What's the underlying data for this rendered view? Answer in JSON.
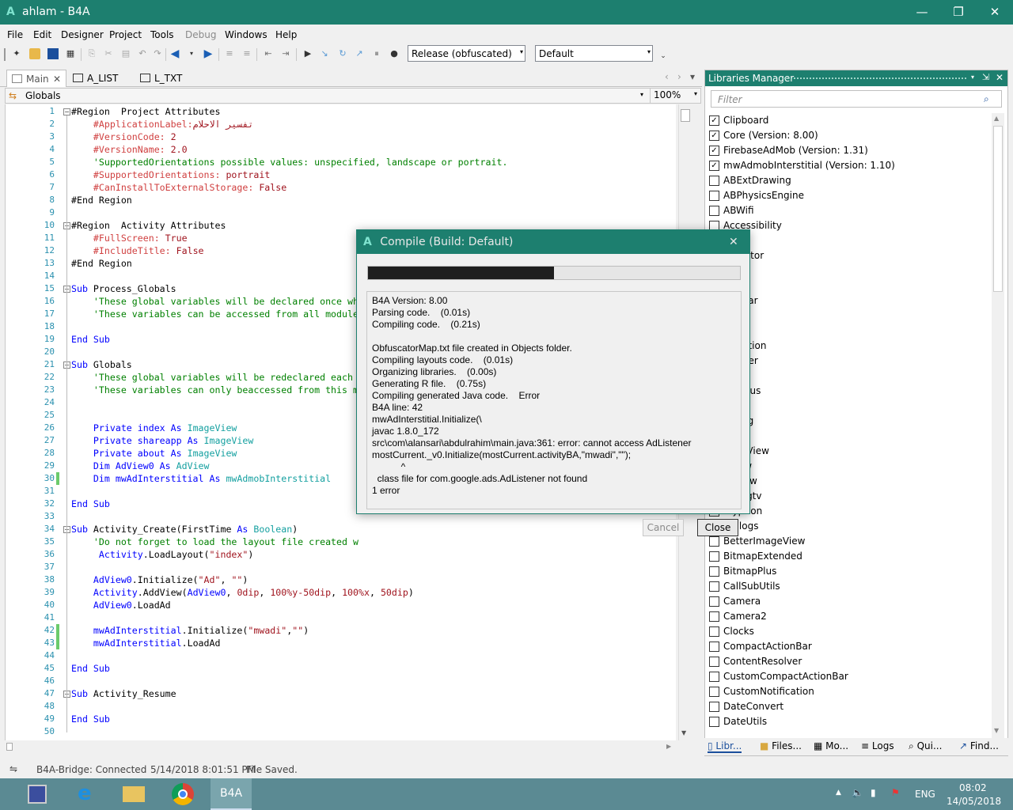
{
  "window": {
    "logo": "A",
    "title": "ahlam - B4A",
    "min": "—",
    "max": "❐",
    "close": "✕"
  },
  "menu": [
    "File",
    "Edit",
    "Designer",
    "Project",
    "Tools",
    "Debug",
    "Windows",
    "Help"
  ],
  "toolbar": {
    "build_config": "Release (obfuscated)",
    "build_config_arrow": "▾",
    "device": "Default",
    "device_arrow": "▾",
    "overflow": "⌄"
  },
  "tabs": [
    {
      "label": "Main",
      "close": "✕"
    },
    {
      "label": "A_LIST"
    },
    {
      "label": "L_TXT"
    }
  ],
  "tab_nav": [
    "‹",
    "›",
    "▾"
  ],
  "module": {
    "selected": "Globals",
    "zoom": "100%",
    "arrow": "▾"
  },
  "code": [
    {
      "n": "1",
      "segs": [
        [
          "#Region  Project Attributes",
          "#000"
        ]
      ]
    },
    {
      "n": "2",
      "segs": [
        [
          "    #ApplicationLabel:",
          "#d04040"
        ],
        [
          "تفسير الاحلام",
          "#a0141e"
        ]
      ]
    },
    {
      "n": "3",
      "segs": [
        [
          "    #VersionCode: ",
          "#d04040"
        ],
        [
          "2",
          "#a0141e"
        ]
      ]
    },
    {
      "n": "4",
      "segs": [
        [
          "    #VersionName: ",
          "#d04040"
        ],
        [
          "2.0",
          "#a0141e"
        ]
      ]
    },
    {
      "n": "5",
      "segs": [
        [
          "    'SupportedOrientations possible values: unspecified, landscape or portrait.",
          "#008000"
        ]
      ]
    },
    {
      "n": "6",
      "segs": [
        [
          "    #SupportedOrientations: ",
          "#d04040"
        ],
        [
          "portrait",
          "#a0141e"
        ]
      ]
    },
    {
      "n": "7",
      "segs": [
        [
          "    #CanInstallToExternalStorage: ",
          "#d04040"
        ],
        [
          "False",
          "#a0141e"
        ]
      ]
    },
    {
      "n": "8",
      "segs": [
        [
          "#End Region",
          "#000"
        ]
      ]
    },
    {
      "n": "9",
      "segs": []
    },
    {
      "n": "10",
      "segs": [
        [
          "#Region  Activity Attributes",
          "#000"
        ]
      ]
    },
    {
      "n": "11",
      "segs": [
        [
          "    #FullScreen: ",
          "#d04040"
        ],
        [
          "True",
          "#a0141e"
        ]
      ]
    },
    {
      "n": "12",
      "segs": [
        [
          "    #IncludeTitle: ",
          "#d04040"
        ],
        [
          "False",
          "#a0141e"
        ]
      ]
    },
    {
      "n": "13",
      "segs": [
        [
          "#End Region",
          "#000"
        ]
      ]
    },
    {
      "n": "14",
      "segs": []
    },
    {
      "n": "15",
      "segs": [
        [
          "Sub ",
          "#0000ff"
        ],
        [
          "Process_Globals",
          "#000"
        ]
      ]
    },
    {
      "n": "16",
      "segs": [
        [
          "    'These global variables will be declared once wh",
          "#008000"
        ]
      ]
    },
    {
      "n": "17",
      "segs": [
        [
          "    'These variables can be accessed from all module",
          "#008000"
        ]
      ]
    },
    {
      "n": "18",
      "segs": []
    },
    {
      "n": "19",
      "segs": [
        [
          "End Sub",
          "#0000ff"
        ]
      ]
    },
    {
      "n": "20",
      "segs": []
    },
    {
      "n": "21",
      "segs": [
        [
          "Sub ",
          "#0000ff"
        ],
        [
          "Globals",
          "#000"
        ]
      ]
    },
    {
      "n": "22",
      "segs": [
        [
          "    'These global variables will be redeclared each",
          "#008000"
        ]
      ]
    },
    {
      "n": "23",
      "segs": [
        [
          "    'These variables can only beaccessed from this m",
          "#008000"
        ]
      ]
    },
    {
      "n": "24",
      "segs": []
    },
    {
      "n": "25",
      "segs": []
    },
    {
      "n": "26",
      "segs": [
        [
          "    Private index As ",
          "#0000ff"
        ],
        [
          "ImageView",
          "#14a0a0"
        ]
      ]
    },
    {
      "n": "27",
      "segs": [
        [
          "    Private shareapp As ",
          "#0000ff"
        ],
        [
          "ImageView",
          "#14a0a0"
        ]
      ]
    },
    {
      "n": "28",
      "segs": [
        [
          "    Private about As ",
          "#0000ff"
        ],
        [
          "ImageView",
          "#14a0a0"
        ]
      ]
    },
    {
      "n": "29",
      "segs": [
        [
          "    Dim AdView0 As ",
          "#0000ff"
        ],
        [
          "AdView",
          "#14a0a0"
        ]
      ]
    },
    {
      "n": "30",
      "segs": [
        [
          "    Dim mwAdInterstitial As ",
          "#0000ff"
        ],
        [
          "mwAdmobInterstitial",
          "#14a0a0"
        ]
      ]
    },
    {
      "n": "31",
      "segs": []
    },
    {
      "n": "32",
      "segs": [
        [
          "End Sub",
          "#0000ff"
        ]
      ]
    },
    {
      "n": "33",
      "segs": []
    },
    {
      "n": "34",
      "segs": [
        [
          "Sub ",
          "#0000ff"
        ],
        [
          "Activity_Create",
          "#000"
        ],
        [
          "(FirstTime ",
          "#000"
        ],
        [
          "As ",
          "#0000ff"
        ],
        [
          "Boolean",
          "#14a0a0"
        ],
        [
          ")",
          "#000"
        ]
      ]
    },
    {
      "n": "35",
      "segs": [
        [
          "    'Do not forget to load the layout file created w",
          "#008000"
        ]
      ]
    },
    {
      "n": "36",
      "segs": [
        [
          "     Activity",
          "#0000ff"
        ],
        [
          ".LoadLayout(",
          "#000"
        ],
        [
          "\"index\"",
          "#a0141e"
        ],
        [
          ")",
          "#000"
        ]
      ]
    },
    {
      "n": "37",
      "segs": []
    },
    {
      "n": "38",
      "segs": [
        [
          "    AdView0",
          "#0000ff"
        ],
        [
          ".Initialize(",
          "#000"
        ],
        [
          "\"Ad\"",
          "#a0141e"
        ],
        [
          ", ",
          "#000"
        ],
        [
          "\"\"",
          "#a0141e"
        ],
        [
          ")",
          "#000"
        ]
      ]
    },
    {
      "n": "39",
      "segs": [
        [
          "    Activity",
          "#0000ff"
        ],
        [
          ".AddView(",
          "#000"
        ],
        [
          "AdView0",
          "#0000ff"
        ],
        [
          ", ",
          "#000"
        ],
        [
          "0dip",
          "#a0141e"
        ],
        [
          ", ",
          "#000"
        ],
        [
          "100%y-50dip",
          "#a0141e"
        ],
        [
          ", ",
          "#000"
        ],
        [
          "100%x",
          "#a0141e"
        ],
        [
          ", ",
          "#000"
        ],
        [
          "50dip",
          "#a0141e"
        ],
        [
          ")",
          "#000"
        ]
      ]
    },
    {
      "n": "40",
      "segs": [
        [
          "    AdView0",
          "#0000ff"
        ],
        [
          ".LoadAd",
          "#000"
        ]
      ]
    },
    {
      "n": "41",
      "segs": []
    },
    {
      "n": "42",
      "segs": [
        [
          "    mwAdInterstitial",
          "#0000ff"
        ],
        [
          ".Initialize(",
          "#000"
        ],
        [
          "\"mwadi\"",
          "#a0141e"
        ],
        [
          ",",
          "#000"
        ],
        [
          "\"\"",
          "#a0141e"
        ],
        [
          ")",
          "#000"
        ]
      ]
    },
    {
      "n": "43",
      "segs": [
        [
          "    mwAdInterstitial",
          "#0000ff"
        ],
        [
          ".LoadAd",
          "#000"
        ]
      ]
    },
    {
      "n": "44",
      "segs": []
    },
    {
      "n": "45",
      "segs": [
        [
          "End Sub",
          "#0000ff"
        ]
      ]
    },
    {
      "n": "46",
      "segs": []
    },
    {
      "n": "47",
      "segs": [
        [
          "Sub ",
          "#0000ff"
        ],
        [
          "Activity_Resume",
          "#000"
        ]
      ]
    },
    {
      "n": "48",
      "segs": []
    },
    {
      "n": "49",
      "segs": [
        [
          "End Sub",
          "#0000ff"
        ]
      ]
    },
    {
      "n": "50",
      "segs": []
    }
  ],
  "libraries": {
    "title": "Libraries Manager",
    "pin": "⇲",
    "close": "✕",
    "filter_placeholder": "Filter",
    "items": [
      {
        "name": "Clipboard",
        "checked": true
      },
      {
        "name": "Core (Version: 8.00)",
        "checked": true
      },
      {
        "name": "FirebaseAdMob (Version: 1.31)",
        "checked": true
      },
      {
        "name": "mwAdmobInterstitial (Version: 1.10)",
        "checked": true
      },
      {
        "name": "ABExtDrawing",
        "checked": false
      },
      {
        "name": "ABPhysicsEngine",
        "checked": false
      },
      {
        "name": "ABWifi",
        "checked": false
      },
      {
        "name": "Accessibility",
        "checked": false
      },
      {
        "name": "",
        "checked": false
      },
      {
        "name": "nistrator",
        "checked": false
      },
      {
        "name": "",
        "checked": false
      },
      {
        "name": "",
        "checked": false
      },
      {
        "name": "tionBar",
        "checked": false
      },
      {
        "name": "ure",
        "checked": false
      },
      {
        "name": "ale",
        "checked": false
      },
      {
        "name": "ickAction",
        "checked": false
      },
      {
        "name": "wPager",
        "checked": false
      },
      {
        "name": "tion",
        "checked": false
      },
      {
        "name": "tionPlus",
        "checked": false
      },
      {
        "name": "mpat",
        "checked": false
      },
      {
        "name": "dating",
        "checked": false
      },
      {
        "name": "",
        "checked": false
      },
      {
        "name": "llleryView",
        "checked": false
      },
      {
        "name": "dView",
        "checked": false
      },
      {
        "name": "istView",
        "checked": false
      },
      {
        "name": "nsungtv",
        "checked": false
      },
      {
        "name": "cryption",
        "checked": false
      },
      {
        "name": "Dialogs",
        "checked": false
      },
      {
        "name": "BetterImageView",
        "checked": false
      },
      {
        "name": "BitmapExtended",
        "checked": false
      },
      {
        "name": "BitmapPlus",
        "checked": false
      },
      {
        "name": "CallSubUtils",
        "checked": false
      },
      {
        "name": "Camera",
        "checked": false
      },
      {
        "name": "Camera2",
        "checked": false
      },
      {
        "name": "Clocks",
        "checked": false
      },
      {
        "name": "CompactActionBar",
        "checked": false
      },
      {
        "name": "ContentResolver",
        "checked": false
      },
      {
        "name": "CustomCompactActionBar",
        "checked": false
      },
      {
        "name": "CustomNotification",
        "checked": false
      },
      {
        "name": "DateConvert",
        "checked": false
      },
      {
        "name": "DateUtils",
        "checked": false
      }
    ],
    "bottom_tabs": [
      "Libr...",
      "Files...",
      "Mo...",
      "Logs",
      "Qui...",
      "Find..."
    ]
  },
  "dialog": {
    "logo": "A",
    "title": "Compile (Build: Default)",
    "close": "✕",
    "progress": 0.5,
    "log": "B4A Version: 8.00\nParsing code.    (0.01s)\nCompiling code.    (0.21s)\n\nObfuscatorMap.txt file created in Objects folder.\nCompiling layouts code.    (0.01s)\nOrganizing libraries.    (0.00s)\nGenerating R file.    (0.75s)\nCompiling generated Java code.    Error\nB4A line: 42\nmwAdInterstitial.Initialize(\\\njavac 1.8.0_172\nsrc\\com\\alansari\\abdulrahim\\main.java:361: error: cannot access AdListener\nmostCurrent._v0.Initialize(mostCurrent.activityBA,\"mwadi\",\"\");\n           ^\n  class file for com.google.ads.AdListener not found\n1 error",
    "cancel": "Cancel",
    "close_btn": "Close"
  },
  "status": {
    "bridge": "B4A-Bridge: Connected",
    "timestamp": "5/14/2018 8:01:51 PM",
    "message": "File Saved."
  },
  "taskbar": {
    "b4a_label": "B4A",
    "lang": "ENG",
    "time": "08:02",
    "date": "14/05/2018",
    "tray_up": "▲"
  },
  "colors": {
    "accent": "#1d7f6f",
    "keyword": "#0000ff",
    "comment": "#008000",
    "string": "#a0141e",
    "attribute": "#d04040",
    "type": "#14a0a0"
  }
}
